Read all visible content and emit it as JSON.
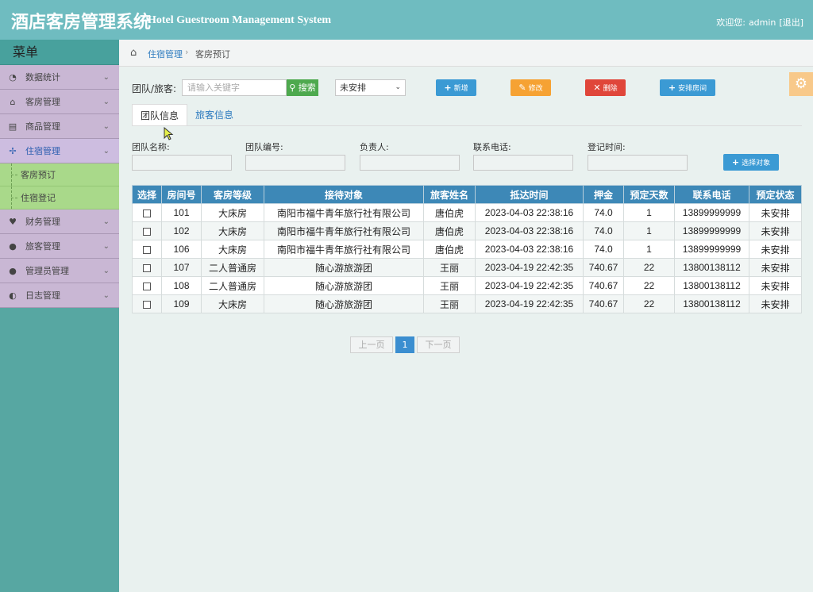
{
  "header": {
    "title": "酒店客房管理系统",
    "subtitle": "Hotel Guestroom Management System",
    "welcome_label": "欢迎您:",
    "user": "admin",
    "logout": "[退出]"
  },
  "sidebar": {
    "menu_title": "菜单",
    "items": [
      {
        "label": "数据统计",
        "icon": "dashboard-icon"
      },
      {
        "label": "客房管理",
        "icon": "home-icon"
      },
      {
        "label": "商品管理",
        "icon": "barrel-icon"
      },
      {
        "label": "住宿管理",
        "icon": "move-icon"
      },
      {
        "label": "财务管理",
        "icon": "heart-icon"
      },
      {
        "label": "旅客管理",
        "icon": "user-icon"
      },
      {
        "label": "管理员管理",
        "icon": "user-icon"
      },
      {
        "label": "日志管理",
        "icon": "contrast-icon"
      }
    ],
    "subitems": [
      "客房预订",
      "住宿登记"
    ]
  },
  "breadcrumb": {
    "parent": "住宿管理",
    "current": "客房预订"
  },
  "toolbar": {
    "filter_label": "团队/旅客:",
    "search_placeholder": "请输入关键字",
    "search_button": "搜索",
    "status_value": "未安排",
    "add": "新增",
    "edit": "修改",
    "delete": "删除",
    "arrange": "安排房间"
  },
  "tabs": {
    "team": "团队信息",
    "guest": "旅客信息"
  },
  "form": {
    "team_name": "团队名称:",
    "team_no": "团队编号:",
    "leader": "负责人:",
    "phone": "联系电话:",
    "reg_time": "登记时间:",
    "select_target": "选择对象"
  },
  "table": {
    "columns": [
      "选择",
      "房间号",
      "客房等级",
      "接待对象",
      "旅客姓名",
      "抵达时间",
      "押金",
      "预定天数",
      "联系电话",
      "预定状态"
    ],
    "rows": [
      [
        "101",
        "大床房",
        "南阳市福牛青年旅行社有限公司",
        "唐伯虎",
        "2023-04-03 22:38:16",
        "74.0",
        "1",
        "13899999999",
        "未安排"
      ],
      [
        "102",
        "大床房",
        "南阳市福牛青年旅行社有限公司",
        "唐伯虎",
        "2023-04-03 22:38:16",
        "74.0",
        "1",
        "13899999999",
        "未安排"
      ],
      [
        "106",
        "大床房",
        "南阳市福牛青年旅行社有限公司",
        "唐伯虎",
        "2023-04-03 22:38:16",
        "74.0",
        "1",
        "13899999999",
        "未安排"
      ],
      [
        "107",
        "二人普通房",
        "随心游旅游团",
        "王丽",
        "2023-04-19 22:42:35",
        "740.67",
        "22",
        "13800138112",
        "未安排"
      ],
      [
        "108",
        "二人普通房",
        "随心游旅游团",
        "王丽",
        "2023-04-19 22:42:35",
        "740.67",
        "22",
        "13800138112",
        "未安排"
      ],
      [
        "109",
        "大床房",
        "随心游旅游团",
        "王丽",
        "2023-04-19 22:42:35",
        "740.67",
        "22",
        "13800138112",
        "未安排"
      ]
    ]
  },
  "pagination": {
    "prev": "上一页",
    "current": "1",
    "next": "下一页"
  }
}
